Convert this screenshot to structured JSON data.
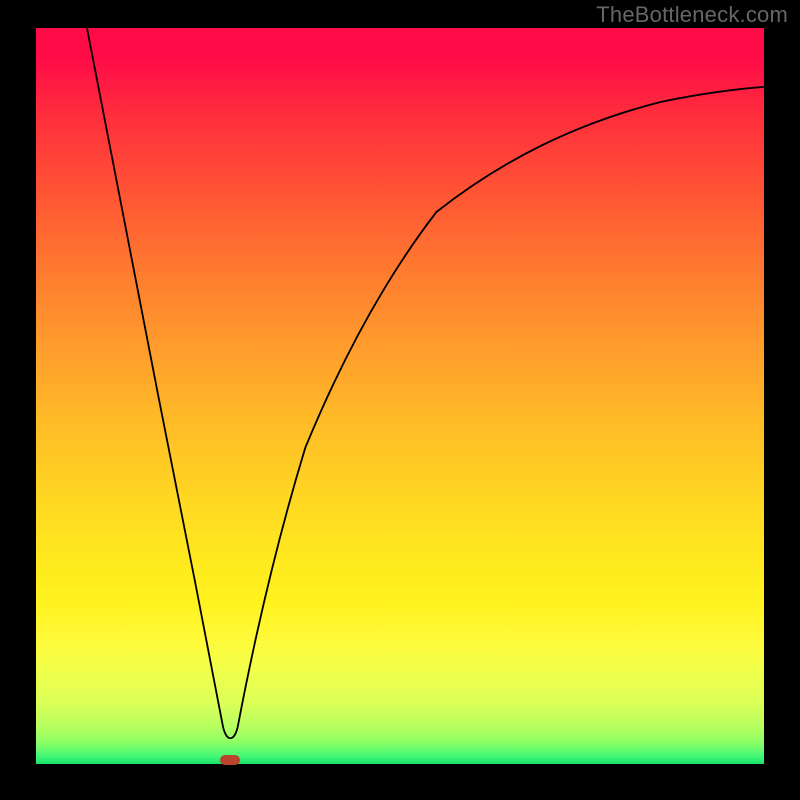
{
  "watermark": {
    "text": "TheBottleneck.com"
  },
  "chart_data": {
    "type": "line",
    "title": "",
    "xlabel": "",
    "ylabel": "",
    "xlim": [
      0,
      1
    ],
    "ylim": [
      0,
      1
    ],
    "grid": false,
    "legend": false,
    "marker": {
      "x": 0.267,
      "y": 0.005,
      "shape": "pill",
      "color": "#bb442d"
    },
    "series": [
      {
        "name": "left-segment",
        "x": [
          0.07,
          0.119,
          0.168,
          0.218,
          0.257
        ],
        "y": [
          1.0,
          0.75,
          0.5,
          0.25,
          0.05
        ]
      },
      {
        "name": "right-segment",
        "x": [
          0.277,
          0.3,
          0.33,
          0.37,
          0.42,
          0.48,
          0.55,
          0.64,
          0.74,
          0.86,
          1.0
        ],
        "y": [
          0.05,
          0.17,
          0.3,
          0.43,
          0.55,
          0.66,
          0.75,
          0.82,
          0.87,
          0.9,
          0.92
        ]
      }
    ],
    "background_gradient": {
      "direction": "vertical",
      "stops": [
        {
          "pos": 0.0,
          "color": "#ff0b48"
        },
        {
          "pos": 0.5,
          "color": "#ffbf27"
        },
        {
          "pos": 0.8,
          "color": "#fff21d"
        },
        {
          "pos": 0.95,
          "color": "#b6ff60"
        },
        {
          "pos": 1.0,
          "color": "#17e06a"
        }
      ]
    }
  }
}
